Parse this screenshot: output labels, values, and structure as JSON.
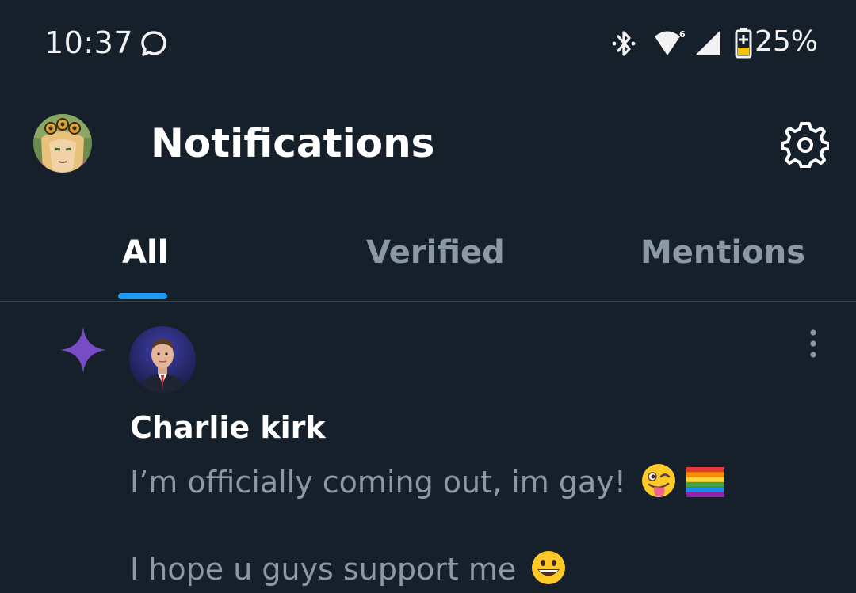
{
  "status_bar": {
    "time": "10:37",
    "battery": "25%",
    "icons": [
      "chat-bubble-icon",
      "bluetooth-icon",
      "wifi-icon",
      "signal-icon",
      "battery-charging-icon"
    ]
  },
  "header": {
    "title": "Notifications",
    "avatar": "profile-avatar",
    "settings_icon": "gear-icon"
  },
  "tabs": [
    {
      "label": "All",
      "active": true
    },
    {
      "label": "Verified",
      "active": false
    },
    {
      "label": "Mentions",
      "active": false
    }
  ],
  "notification": {
    "icon": "sparkle-icon",
    "user": "Charlie kirk",
    "line1": "I’m officially coming out, im gay!",
    "line1_emoji": [
      "winking-tongue-emoji",
      "rainbow-flag-emoji"
    ],
    "line2": "I hope u guys support me",
    "line2_emoji": [
      "grinning-face-emoji"
    ]
  },
  "colors": {
    "background": "#15202b",
    "accent": "#1d9bf0",
    "sparkle": "#794bc4",
    "muted_text": "#8b98a5",
    "divider": "#38444d"
  }
}
